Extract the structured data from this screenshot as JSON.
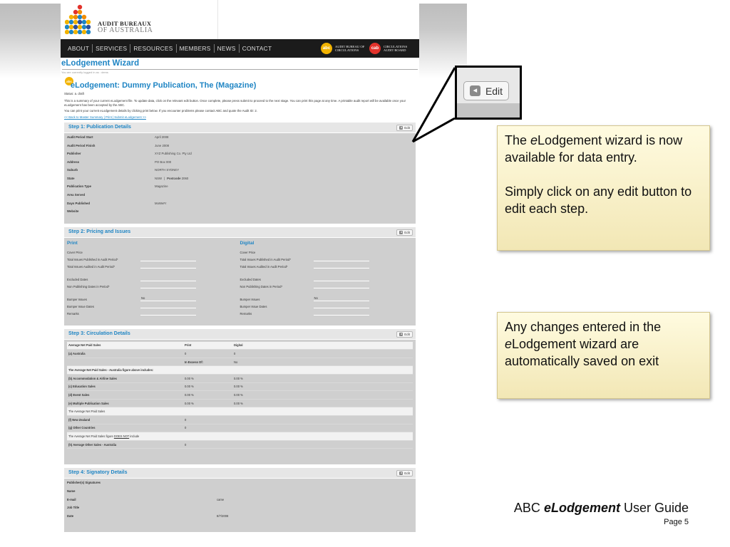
{
  "logo": {
    "line1": "AUDIT BUREAUX",
    "line2": "OF AUSTRALIA"
  },
  "nav": {
    "items": [
      "ABOUT",
      "SERVICES",
      "RESOURCES",
      "MEMBERS",
      "NEWS",
      "CONTACT"
    ],
    "badge1": {
      "label": "abc",
      "text": "AUDIT BUREAU OF CIRCULATIONS",
      "color": "#f2b300"
    },
    "badge2": {
      "label": "cab",
      "text": "CIRCULATIONS AUDIT BOARD",
      "color": "#e2322b"
    }
  },
  "wizard_title": "eLodgement Wizard",
  "logged_in": "You are currently logged in as : dems",
  "doc": {
    "badge": "abc",
    "title": "eLodgement: Dummy Publication, The (Magazine)",
    "status": "Status: a. draft",
    "para1": "This is a summary of your current eLodgement file. To update data, click on the relevant edit button. Once complete, please press submit to proceed to the next stage. You can print this page at any time. A printable audit report will be available once your eLodgement has been accepted by the ABC.",
    "para2": "You can print your current eLodgement details by clicking print below. If you encounter problems please contact ABC and quote the Audit ID: 2.",
    "links": "<< Back to Master Summary | Print | Submit eLodgement >>"
  },
  "edit_label": "Edit",
  "step1": {
    "title": "Step 1: Publication Details",
    "rows": [
      {
        "k": "Audit Period Start",
        "v": "April 2008"
      },
      {
        "k": "Audit Period Finish",
        "v": "June 2008"
      },
      {
        "k": "Publisher",
        "v": "XYZ Publishing Co. Pty Ltd"
      },
      {
        "k": "Address",
        "v": "PO Box 000"
      },
      {
        "k": "Suburb",
        "v": "NORTH SYDNEY"
      },
      {
        "k": "State",
        "v": "NSW"
      },
      {
        "k": "Publication Type",
        "v": "Magazine"
      },
      {
        "k": "Area Served",
        "v": ""
      },
      {
        "k": "Days Published",
        "v": "MoWeFr"
      },
      {
        "k": "Website",
        "v": ""
      }
    ],
    "postcode_label": "Postcode",
    "postcode": "2060"
  },
  "step2": {
    "title": "Step 2: Pricing and Issues",
    "print": {
      "head": "Print",
      "cover": "Cover Price",
      "published": "Total Issues Published in Audit Period*",
      "audited": "Total Issues Audited in Audit Period*",
      "excluded": "Excluded Dates",
      "nonpub": "Non Publishing Dates in Period*",
      "bumper": "Bumper Issues",
      "bumper_val": "No",
      "bumper_dates": "Bumper Issue Dates",
      "remarks": "Remarks"
    },
    "digital": {
      "head": "Digital",
      "cover": "Cover Price",
      "published": "Total Issues Published in Audit Period*",
      "audited": "Total Issues Audited in Audit Period*",
      "excluded": "Excluded Dates",
      "nonpub": "Non Publishing Dates in Period*",
      "bumper": "Bumper Issues",
      "bumper_val": "No",
      "bumper_dates": "Bumper Issue Dates",
      "remarks": "Remarks"
    }
  },
  "step3": {
    "title": "Step 3: Circulation Details",
    "header": [
      "Average Net Paid Sales",
      "Print",
      "Digital"
    ],
    "r1": [
      "(a) Australia",
      "0",
      "0"
    ],
    "r2": [
      "",
      "In Excess Of:",
      "No"
    ],
    "r3": "The Average Net Paid Sales - Australia figure above includes:",
    "r4": [
      "(b) Accommodation & Airline Sales",
      "0.00 %",
      "0.00 %"
    ],
    "r5": [
      "(c) Education Sales",
      "0.00 %",
      "0.00 %"
    ],
    "r6": [
      "(d) Event Sales",
      "0.00 %",
      "0.00 %"
    ],
    "r7": [
      "(e) Multiple Publication Sales",
      "0.00 %",
      "0.00 %"
    ],
    "r8": "The Average Net Paid Sales",
    "r9": [
      "(f) New Zealand",
      "0"
    ],
    "r10": [
      "(g) Other Countries",
      "0"
    ],
    "r11a": "The Average Net Paid Sales figure",
    "r11b": "DOES NOT",
    "r11c": "include",
    "r12": [
      "(h) Average Other Sales - Australia",
      "0"
    ]
  },
  "step4": {
    "title": "Step 4: Signatory Details",
    "rows": [
      {
        "k": "Publisher(s) Signatures",
        "v": ""
      },
      {
        "k": "Name",
        "v": ""
      },
      {
        "k": "E-mail",
        "v": "came"
      },
      {
        "k": "Job Title",
        "v": ""
      },
      {
        "k": "Date",
        "v": "8/7/2008"
      }
    ]
  },
  "callout": {
    "label": "Edit"
  },
  "note1": {
    "a_pre": "The ",
    "a_em": "e",
    "a_post": "Lodgement wizard is now available for data entry.",
    "b": "Simply click on any edit button to edit each step."
  },
  "note2": {
    "pre": "Any changes entered in the ",
    "em": "e",
    "post": "Lodgement wizard are automatically saved on exit"
  },
  "footer": {
    "pre": "ABC ",
    "em": "eLodgement",
    "post": " User Guide",
    "page": "Page 5"
  }
}
